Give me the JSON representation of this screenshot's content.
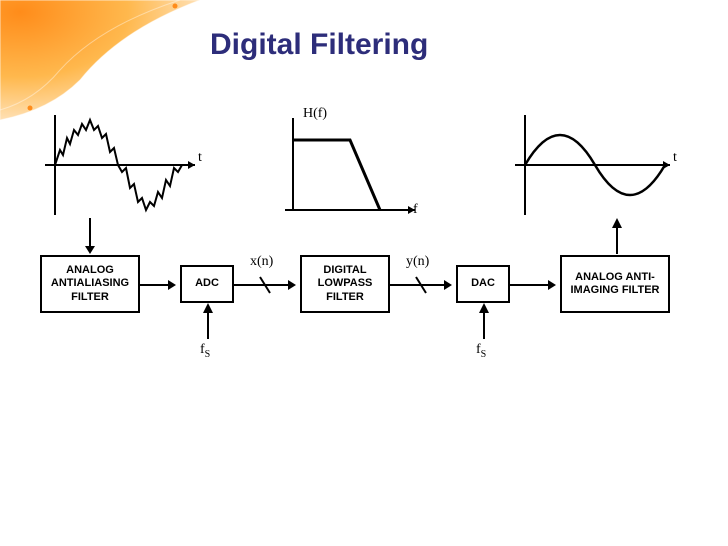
{
  "title": "Digital Filtering",
  "graphs": {
    "input": {
      "xaxis": "t"
    },
    "transfer": {
      "ylabel": "H(f)",
      "xaxis": "f"
    },
    "output": {
      "xaxis": "t"
    }
  },
  "blocks": {
    "b1": "ANALOG ANTIALIASING FILTER",
    "b2": "ADC",
    "b3": "DIGITAL LOWPASS FILTER",
    "b4": "DAC",
    "b5": "ANALOG ANTI-IMAGING FILTER"
  },
  "signals": {
    "xn": "x(n)",
    "yn": "y(n)",
    "fs": "f",
    "fs_sub": "S"
  }
}
